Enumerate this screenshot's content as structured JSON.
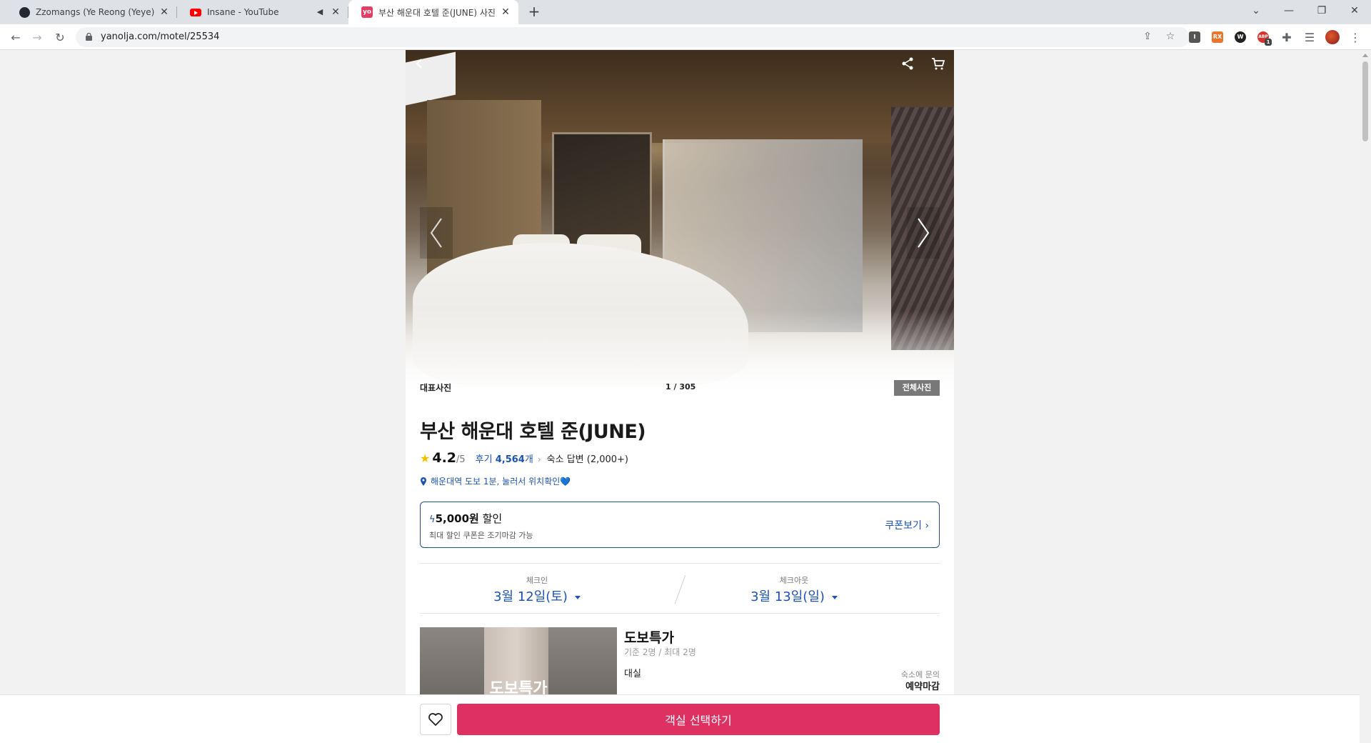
{
  "browser": {
    "tabs": [
      {
        "title": "Zzomangs (Ye Reong (Yeye))",
        "favicon": "github-icon"
      },
      {
        "title": "Insane - YouTube",
        "favicon": "youtube-icon"
      },
      {
        "title": "부산 해운대 호텔 준(JUNE) 사진",
        "favicon": "yanolja-icon",
        "favicon_text": "yo"
      }
    ],
    "url": "yanolja.com/motel/25534",
    "extensions": [
      "I",
      "RX",
      "W",
      "ABP"
    ],
    "ext_badge": "1"
  },
  "gallery": {
    "label": "대표사진",
    "counter": "1 / 305",
    "all_photos": "전체사진"
  },
  "hotel": {
    "name": "부산 해운대 호텔 준(JUNE)",
    "rating": "4.2",
    "rating_max": "/5",
    "review_prefix": "후기 ",
    "review_count": "4,564",
    "review_suffix": "개",
    "host_reply": "숙소 답변 (2,000+)",
    "location": "해운대역 도보 1분, 눌러서 위치확인💙"
  },
  "coupon": {
    "amount": "5,000원",
    "amount_suffix": " 할인",
    "note": "최대 할인 쿠폰은 조기마감 가능",
    "view_label": "쿠폰보기"
  },
  "dates": {
    "checkin_label": "체크인",
    "checkin_value": "3월 12일(토)",
    "checkout_label": "체크아웃",
    "checkout_value": "3월 13일(일)"
  },
  "room": {
    "thumb_text": "도보특가",
    "name": "도보특가",
    "capacity": "기준 2명 / 최대 2명",
    "type": "대실",
    "inquiry": "숙소에 문의",
    "status": "예약마감"
  },
  "bottom": {
    "select_label": "객실 선택하기"
  },
  "colors": {
    "accent": "#df3161",
    "link": "#1b53b6",
    "coupon_border": "#1f4f8c",
    "star": "#f6c000"
  }
}
